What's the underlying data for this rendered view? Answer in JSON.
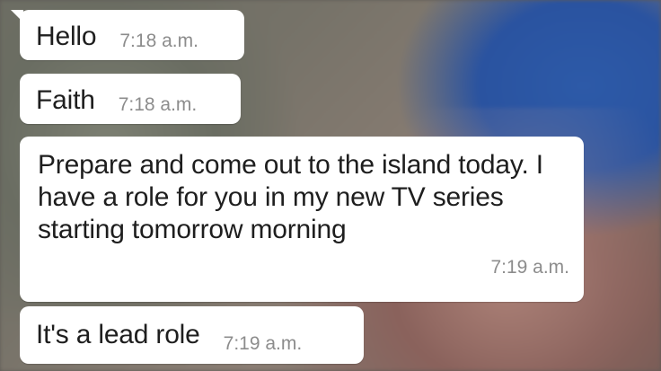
{
  "chat": {
    "messages": [
      {
        "text": "Hello",
        "time": "7:18 a.m."
      },
      {
        "text": "Faith",
        "time": "7:18 a.m."
      },
      {
        "text": "Prepare and come out to the island today. I have a role for you in my new TV series starting tomorrow morning",
        "time": "7:19 a.m."
      },
      {
        "text": "It's a lead role",
        "time": "7:19 a.m."
      }
    ]
  },
  "colors": {
    "bubble_bg": "#ffffff",
    "message_text": "#1e1e1e",
    "timestamp_text": "#8c8c8c"
  }
}
